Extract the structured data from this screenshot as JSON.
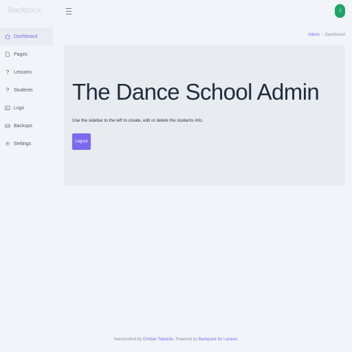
{
  "brand": {
    "bold": "Back",
    "light": "pack"
  },
  "header": {
    "avatar_initial": "J"
  },
  "sidebar": {
    "items": [
      {
        "label": "Dashboard",
        "icon": "home-icon",
        "active": true
      },
      {
        "label": "Pages",
        "icon": "file-icon"
      },
      {
        "label": "Lessons",
        "icon": "question-icon"
      },
      {
        "label": "Students",
        "icon": "question-icon"
      },
      {
        "label": "Logs",
        "icon": "terminal-icon"
      },
      {
        "label": "Backups",
        "icon": "hdd-icon"
      },
      {
        "label": "Settings",
        "icon": "cog-icon"
      }
    ]
  },
  "breadcrumb": {
    "first": "Admin",
    "separator": "/",
    "current": "Dashboard"
  },
  "main": {
    "title": "The Dance School Admin",
    "description": "Use the sidebar to the left to create, edit or delete the students info.",
    "logout_label": "Logout"
  },
  "footer": {
    "text1": "Handcrafted by ",
    "author": "Cristian Tabacitu",
    "text2": ". Powered by ",
    "powered": "Backpack for Laravel",
    "text3": "."
  },
  "colors": {
    "accent": "#7c69ef",
    "avatar": "#1fa463",
    "background": "#f1f4f8",
    "jumbotron": "#e8ebf0"
  }
}
